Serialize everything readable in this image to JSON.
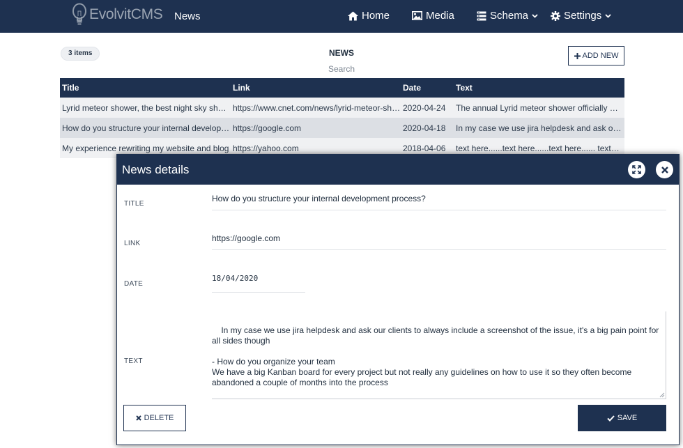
{
  "navbar": {
    "brand": "EvolvitCMS",
    "section": "News",
    "items": [
      {
        "label": "Home",
        "icon": "home-icon"
      },
      {
        "label": "Media",
        "icon": "image-icon"
      },
      {
        "label": "Schema",
        "icon": "database-icon",
        "dropdown": true
      },
      {
        "label": "Settings",
        "icon": "gear-icon",
        "dropdown": true
      }
    ]
  },
  "list": {
    "count": "3 items",
    "title": "NEWS",
    "search": "Search",
    "add_label": "ADD NEW",
    "columns": [
      "Title",
      "Link",
      "Date",
      "Text"
    ],
    "rows": [
      {
        "title": "Lyrid meteor shower, the best night sky show of April",
        "link": "https://www.cnet.com/news/lyrid-meteor-shower",
        "date": "2020-04-24",
        "text": "The annual Lyrid meteor shower officially peaks"
      },
      {
        "title": "How do you structure your internal development process?",
        "link": "https://google.com",
        "date": "2020-04-18",
        "text": "In my case we use jira helpdesk and ask our clients"
      },
      {
        "title": "My experience rewriting my website and blog",
        "link": "https://yahoo.com",
        "date": "2018-04-06",
        "text": "text here......text here......text here...... text here"
      }
    ]
  },
  "modal": {
    "title": "News details",
    "fields": {
      "title_label": "TITLE",
      "title_value": "How do you structure your internal development process?",
      "link_label": "LINK",
      "link_value": "https://google.com",
      "date_label": "DATE",
      "date_value": "18/04/2020",
      "text_label": "TEXT",
      "text_value": "In my case we use jira helpdesk and ask our clients to always include a screenshot of the issue, it's a big pain point for all sides though\n\n- How do you organize your team\nWe have a big Kanban board for every project but not really any guidelines on how to use it so they often become abandoned a couple of months into the process"
    },
    "delete_label": "DELETE",
    "save_label": "SAVE"
  },
  "colors": {
    "primary": "#1e3150",
    "row_alt": "#f0f1f3",
    "row_selected": "#dcdfe4"
  }
}
